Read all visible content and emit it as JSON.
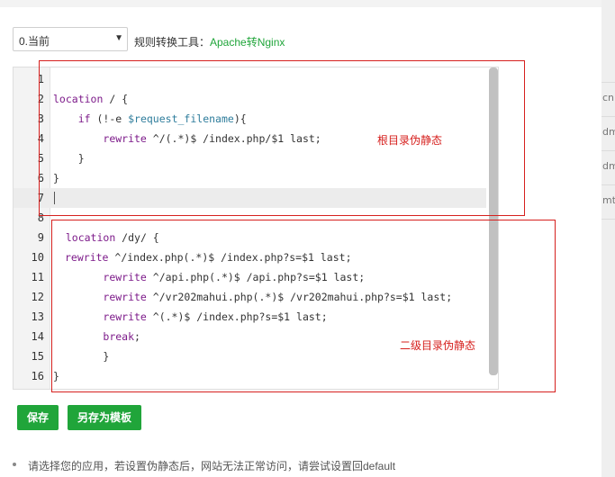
{
  "select": {
    "value": "0.当前"
  },
  "tool": {
    "label": "规则转换工具：",
    "link": "Apache转Nginx"
  },
  "editor": {
    "lines": [
      {
        "n": "1",
        "html": ""
      },
      {
        "n": "2",
        "html": "<span class=\"kw\">location</span> / {"
      },
      {
        "n": "3",
        "html": "    <span class=\"kw\">if</span> (!-e <span class=\"var\">$request_filename</span>){"
      },
      {
        "n": "4",
        "html": "        <span class=\"kw\">rewrite</span> ^/(.*)$ /index.php/$1 last;"
      },
      {
        "n": "5",
        "html": "    }"
      },
      {
        "n": "6",
        "html": "}"
      },
      {
        "n": "7",
        "html": ""
      },
      {
        "n": "8",
        "html": ""
      },
      {
        "n": "9",
        "html": "  <span class=\"kw\">location</span> /dy/ {"
      },
      {
        "n": "10",
        "html": "<span class=\"kw\">rewrite</span> ^/index.php(.*)$ /index.php?s=$1 last;"
      },
      {
        "n": "11",
        "html": "        <span class=\"kw\">rewrite</span> ^/api.php(.*)$ /api.php?s=$1 last;"
      },
      {
        "n": "12",
        "html": "        <span class=\"kw\">rewrite</span> ^/vr202mahui.php(.*)$ /vr202mahui.php?s=$1 last;"
      },
      {
        "n": "13",
        "html": "        <span class=\"kw\">rewrite</span> ^(.*)$ /index.php?s=$1 last;"
      },
      {
        "n": "14",
        "html": "        <span class=\"kw\">break</span>;"
      },
      {
        "n": "15",
        "html": "        }"
      },
      {
        "n": "16",
        "html": "}"
      }
    ]
  },
  "annotations": {
    "root": "根目录伪静态",
    "sub": "二级目录伪静态"
  },
  "buttons": {
    "save": "保存",
    "save_template": "另存为模板"
  },
  "tip": "请选择您的应用，若设置伪静态后，网站无法正常访问，请尝试设置回default",
  "right_fragments": [
    "cn",
    "dm",
    "dm",
    "mt"
  ],
  "colors": {
    "accent": "#20a53a",
    "annotation": "#d6201e",
    "keyword": "#7d1b8a"
  }
}
